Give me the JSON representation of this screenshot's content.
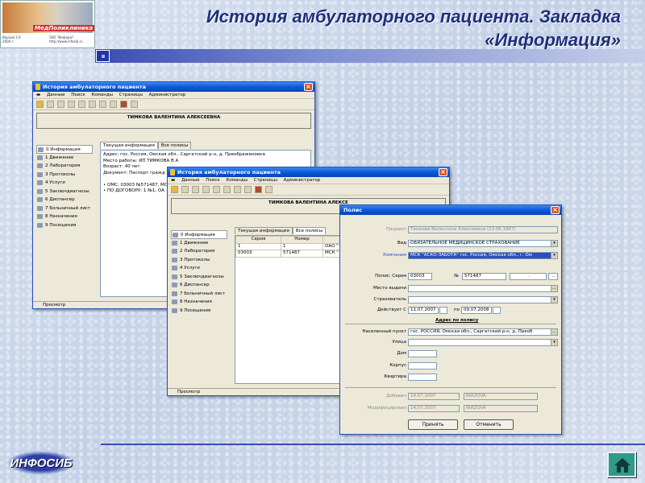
{
  "slide": {
    "title": "История амбулаторного пациента. Закладка «Информация»",
    "thumb_brand": "МедПоликлиника",
    "thumb_lines": [
      "Версия 2.0",
      "2004 г.",
      "ЗАО \"Информ\"",
      "http://www.infosib.ru"
    ],
    "logo_text": "ИНФОСИБ",
    "accent_color": "#1f2f7a"
  },
  "win1": {
    "title": "История амбулаторного пациента",
    "menu": [
      "Данные",
      "Поиск",
      "Команды",
      "Страницы",
      "Администратор"
    ],
    "patient": "ТИМКОВА ВАЛЕНТИНА АЛЕКСЕЕВНА",
    "sidebar": [
      "0 Информация",
      "1 Движение",
      "2 Лаборатория",
      "3 Протоколы",
      "4 Услуги",
      "5 Заключдиагнозы",
      "6 Диспансер",
      "7 Больничный лист",
      "8 Назначения",
      "9 Посещения"
    ],
    "tabs": [
      "Текущая информация",
      "Все полисы"
    ],
    "info_lines": [
      "Адрес: гос. Россия, Омская обл., Саргатский р-н, д. Преображеновка",
      "Место работы: ИП ТИМКОВА В А",
      "Возраст: 40 лет",
      "Документ: Паспорт гражд",
      "",
      "•  ОМС: 03003 №571487, МС",
      "•  ПО ДОГОВОРУ: 1 №1, ОА"
    ],
    "status": "Просмотр"
  },
  "win2": {
    "title": "История амбулаторного пациента",
    "menu": [
      "Данные",
      "Поиск",
      "Команды",
      "Страницы",
      "Администратор"
    ],
    "patient": "ТИМКОВА ВАЛЕНТИНА АЛЕКСЕ",
    "sidebar": [
      "0 Информация",
      "1 Движение",
      "2 Лаборатория",
      "3 Протоколы",
      "4 Услуги",
      "5 Заключдиагнозы",
      "6 Диспансер",
      "7 Больничный лист",
      "8 Назначения",
      "9 Посещения"
    ],
    "tabs": [
      "Текущая информация",
      "Все полисы"
    ],
    "columns": [
      "Серия",
      "Номер",
      ""
    ],
    "rows": [
      [
        "1",
        "1",
        "ОАО \""
      ],
      [
        "03003",
        "571487",
        "МСК \""
      ]
    ],
    "status": "Просмотр"
  },
  "polis": {
    "title": "Полис",
    "patient_label": "Пациент",
    "patient_value": "Тимкова Валентина Алексеевна (23.06.1967)",
    "vid_label": "Вид",
    "vid_value": "ОБЯЗАТЕЛЬНОЕ МЕДИЦИНСКОЕ СТРАХОВАНИЕ",
    "company_label": "Компания",
    "company_value": "МСК \"АСКО-ЗАБОТА\" гос. Россия, Омская обл., г. Ом",
    "seria_label": "Полис: Серия",
    "seria_value": "03003",
    "num_label": "№",
    "num_value": "571487",
    "extra_value": ".",
    "issued_label": "Место выдачи",
    "insurer_label": "Страхователь",
    "valid_label": "Действует С",
    "valid_from": "11.07.2007",
    "valid_to_label": "по",
    "valid_to": "09.07.2008",
    "address_header": "Адрес по полису",
    "locality_label": "Населенный пункт",
    "locality_value": "гос. РОССИЯ, Омская обл., Саргатский р-н, д. Преоб",
    "street_label": "Улица",
    "house_label": "Дом",
    "building_label": "Корпус",
    "apartment_label": "Квартира",
    "added_label": "Добавил",
    "added_date": "14.07.2007",
    "added_user": "NIAZOVA",
    "modified_label": "Модифицировал",
    "modified_date": "14.07.2007",
    "modified_user": "NIAZOVA",
    "ok_label": "Принять",
    "cancel_label": "Отменить"
  }
}
